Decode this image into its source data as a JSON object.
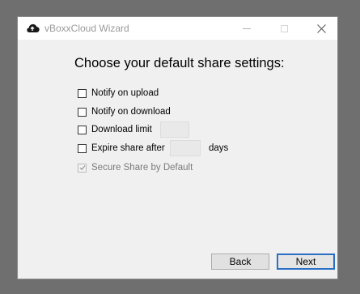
{
  "window": {
    "title": "vBoxxCloud Wizard",
    "icon": "cloud-upload-icon"
  },
  "heading": "Choose your default share settings:",
  "options": [
    {
      "label": "Notify on upload",
      "checked": false,
      "enabled": true
    },
    {
      "label": "Notify on download",
      "checked": false,
      "enabled": true
    },
    {
      "label": "Download limit",
      "checked": false,
      "enabled": true,
      "input_value": ""
    },
    {
      "label": "Expire share after",
      "checked": false,
      "enabled": true,
      "input_value": "",
      "suffix": "days"
    },
    {
      "label": "Secure Share by Default",
      "checked": true,
      "enabled": false
    }
  ],
  "buttons": {
    "back": "Back",
    "next": "Next"
  },
  "colors": {
    "accent": "#2b6fc4",
    "window_bg": "#f0f0f0",
    "backdrop": "#6f6f6f"
  }
}
